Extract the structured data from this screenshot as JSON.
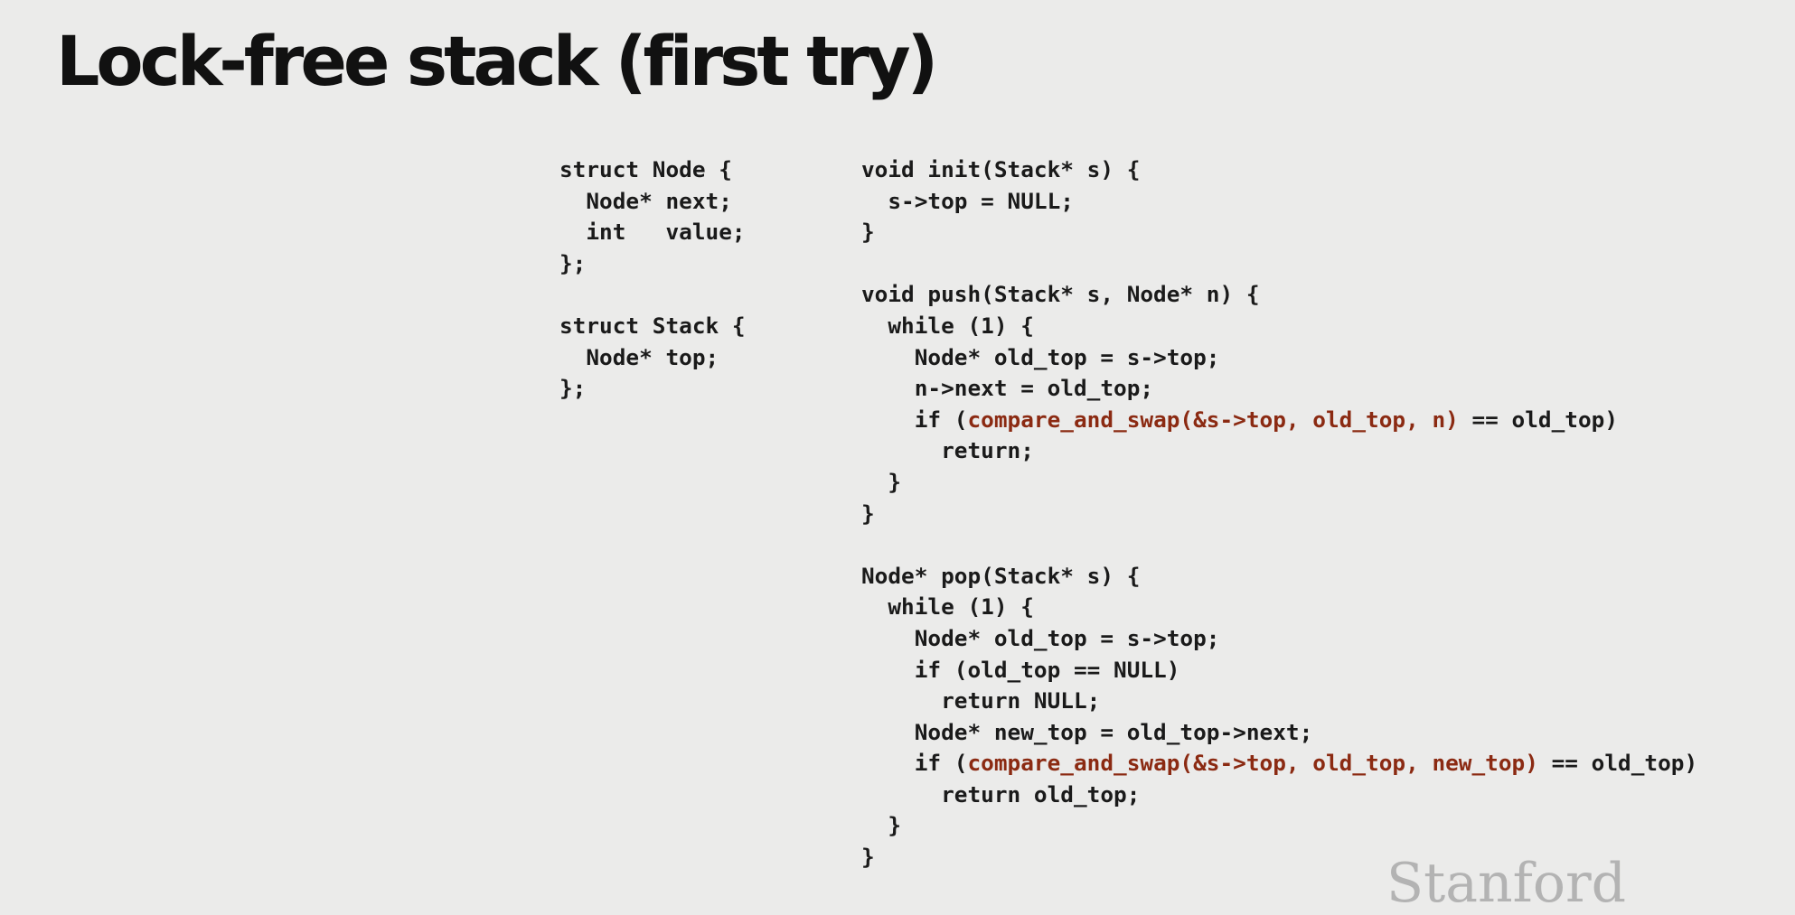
{
  "slide": {
    "title": "Lock-free stack (first try)",
    "logo": "Stanford"
  },
  "code_left": [
    "struct Node {",
    "  Node* next;",
    "  int   value;",
    "};",
    "",
    "struct Stack {",
    "  Node* top;",
    "};"
  ],
  "code_right": [
    "void init(Stack* s) {",
    "  s->top = NULL;",
    "}",
    "",
    "void push(Stack* s, Node* n) {",
    "  while (1) {",
    "    Node* old_top = s->top;",
    "    n->next = old_top;",
    "    if (compare_and_swap(&s->top, old_top, n) == old_top)",
    "      return;",
    "  }",
    "}",
    "",
    "Node* pop(Stack* s) {",
    "  while (1) {",
    "    Node* old_top = s->top;",
    "    if (old_top == NULL)",
    "      return NULL;",
    "    Node* new_top = old_top->next;",
    "    if (compare_and_swap(&s->top, old_top, new_top) == old_top)",
    "      return old_top;",
    "  }",
    "}"
  ],
  "highlight": {
    "color": "#8b2a12",
    "push_cas_call": "compare_and_swap(&s->top, old_top, n)",
    "pop_cas_call": "compare_and_swap(&s->top, old_top, new_top)"
  }
}
